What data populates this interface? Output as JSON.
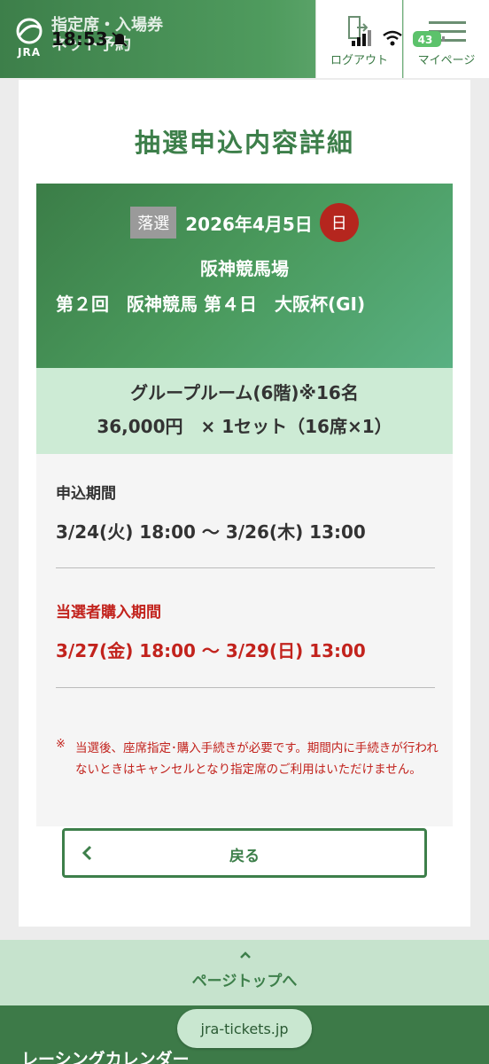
{
  "status_bar": {
    "time": "18:53",
    "battery": "43"
  },
  "header": {
    "logo_text": "JRA",
    "site_name_line1": "指定席・入場券",
    "site_name_line2": "ネット予約",
    "logout_label": "ログアウト",
    "mypage_label": "マイページ"
  },
  "page": {
    "title": "抽選申込内容詳細"
  },
  "event": {
    "result_badge": "落選",
    "date": "2026年4月5日",
    "weekday": "日",
    "venue": "阪神競馬場",
    "race": "第２回　阪神競馬 第４日　大阪杯(GⅠ)"
  },
  "seat": {
    "name": "グループルーム(6階)※16名",
    "price_line": "36,000円　× 1セット（16席×1）"
  },
  "periods": {
    "application_label": "申込期間",
    "application_value": "3/24(火) 18:00 〜 3/26(木) 13:00",
    "purchase_label": "当選者購入期間",
    "purchase_value": "3/27(金) 18:00 〜 3/29(日) 13:00"
  },
  "note": {
    "mark": "※",
    "text": "当選後、座席指定･購入手続きが必要です。期間内に手続きが行われないときはキャンセルとなり指定席のご利用はいただけません。"
  },
  "buttons": {
    "back_label": "戻る"
  },
  "page_top": {
    "label": "ページトップへ"
  },
  "footer": {
    "title": "レーシングカレンダー",
    "url": "jra-tickets.jp"
  }
}
